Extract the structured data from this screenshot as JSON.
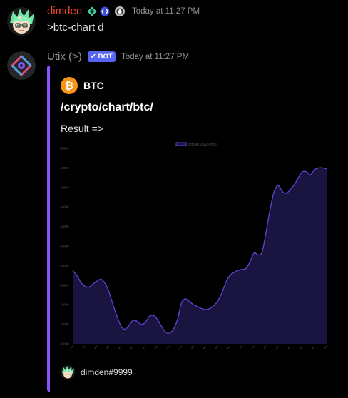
{
  "messages": [
    {
      "username": "dimden",
      "username_color": "#f0472b",
      "timestamp": "Today at 11:27 PM",
      "content": ">btc-chart d"
    },
    {
      "username": "Utix (>)",
      "username_color": "#8e9297",
      "bot_tag": "BOT",
      "timestamp": "Today at 11:27 PM",
      "embed": {
        "color": "#8c52ff",
        "author": "BTC",
        "author_icon": "bitcoin-icon",
        "title": "/crypto/chart/btc/",
        "description": "Result =>",
        "footer": "dimden#9999"
      }
    }
  ],
  "chart_data": {
    "type": "area",
    "legend": [
      "Bitcoin USD Price"
    ],
    "legend_position": "top",
    "ylim": [
      30000,
      50000
    ],
    "yticks": [
      30000,
      32000,
      34000,
      36000,
      38000,
      40000,
      42000,
      44000,
      46000,
      48000,
      50000
    ],
    "line_color": "#5b47d6",
    "fill_color": "#1a1440",
    "series": [
      {
        "name": "Bitcoin USD Price",
        "values": [
          37500,
          37000,
          36300,
          35900,
          35800,
          36100,
          36400,
          36600,
          36200,
          35300,
          34000,
          32800,
          31800,
          31500,
          31900,
          32400,
          32300,
          32000,
          32200,
          32800,
          32900,
          32500,
          31800,
          31200,
          31100,
          31500,
          32500,
          34200,
          34600,
          34300,
          34000,
          33800,
          33600,
          33500,
          33600,
          33900,
          34400,
          35200,
          36300,
          37000,
          37300,
          37500,
          37600,
          37700,
          38400,
          39300,
          39100,
          39400,
          41500,
          43800,
          45600,
          46200,
          45600,
          45400,
          45800,
          46300,
          47000,
          47600,
          47600,
          47300,
          47800,
          48000,
          48000,
          47900
        ]
      }
    ]
  }
}
